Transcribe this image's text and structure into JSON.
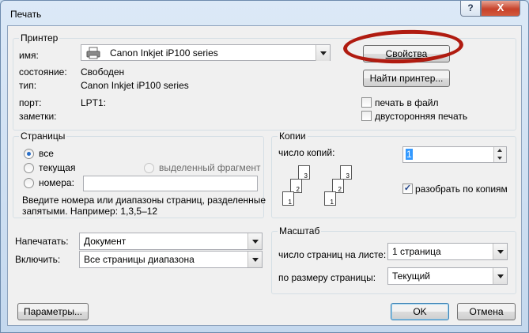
{
  "window": {
    "title": "Печать",
    "help": "?",
    "close": "X"
  },
  "printer": {
    "group_label": "Принтер",
    "name_label": "имя:",
    "name_value": "Canon Inkjet iP100 series",
    "status_label": "состояние:",
    "status_value": "Свободен",
    "type_label": "тип:",
    "type_value": "Canon Inkjet iP100 series",
    "port_label": "порт:",
    "port_value": "LPT1:",
    "notes_label": "заметки:",
    "properties_button": "Свойства",
    "find_button": "Найти принтер...",
    "print_to_file": {
      "label": "печать в файл",
      "checked": false
    },
    "duplex": {
      "label": "двусторонняя печать",
      "checked": false
    }
  },
  "pages": {
    "group_label": "Страницы",
    "all": {
      "label": "все",
      "selected": true
    },
    "current": {
      "label": "текущая",
      "selected": false
    },
    "selection": {
      "label": "выделенный фрагмент",
      "enabled": false
    },
    "numbers": {
      "label": "номера:",
      "selected": false,
      "value": ""
    },
    "hint_line1": "Введите номера или диапазоны страниц, разделенные",
    "hint_line2": "запятыми. Например: 1,3,5–12"
  },
  "copies": {
    "group_label": "Копии",
    "count_label": "число копий:",
    "count_value": "1",
    "collate": {
      "label": "разобрать по копиям",
      "checked": true
    },
    "icon_pages": [
      "1",
      "2",
      "3"
    ]
  },
  "print_what": {
    "label": "Напечатать:",
    "value": "Документ"
  },
  "include": {
    "label": "Включить:",
    "value": "Все страницы диапазона"
  },
  "zoom": {
    "group_label": "Масштаб",
    "pages_per_sheet_label": "число страниц на листе:",
    "pages_per_sheet_value": "1 страница",
    "scale_label": "по размеру страницы:",
    "scale_value": "Текущий"
  },
  "footer": {
    "options_button": "Параметры...",
    "ok_button": "OK",
    "cancel_button": "Отмена"
  },
  "annotation": {
    "color": "#b01b10",
    "target": "properties-button"
  }
}
